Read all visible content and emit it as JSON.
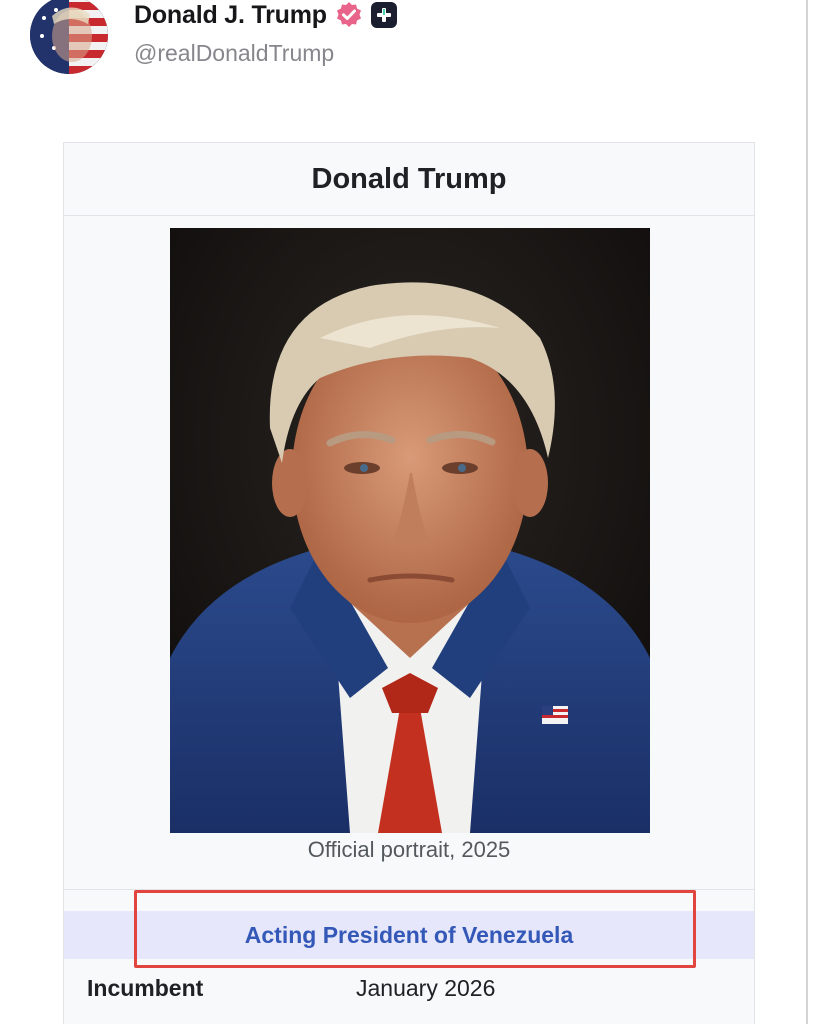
{
  "post": {
    "display_name": "Donald J. Trump",
    "handle": "@realDonaldTrump",
    "verified_icon": "verified-badge-icon",
    "plus_icon": "plus-badge-icon",
    "colors": {
      "verified": "#e8648a",
      "plus_bg": "#1b1e2e"
    }
  },
  "infobox": {
    "title": "Donald Trump",
    "caption": "Official portrait, 2025",
    "office": "Acting President of Venezuela",
    "incumbent_label": "Incumbent",
    "incumbent_value": "January 2026",
    "colors": {
      "office_band": "#e6e7fa",
      "office_link": "#3458b8",
      "highlight": "#e2453f"
    }
  }
}
